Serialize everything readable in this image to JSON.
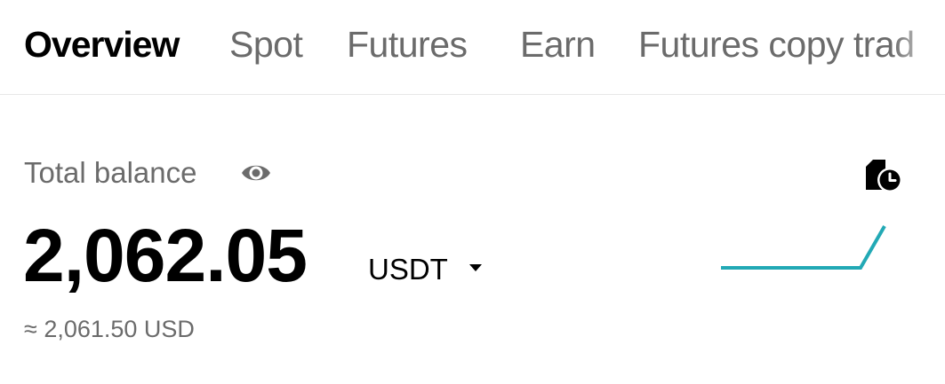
{
  "tabs": [
    {
      "label": "Overview",
      "active": true
    },
    {
      "label": "Spot",
      "active": false
    },
    {
      "label": "Futures",
      "active": false
    },
    {
      "label": "Earn",
      "active": false
    },
    {
      "label": "Futures copy trad",
      "active": false
    }
  ],
  "balance": {
    "label": "Total balance",
    "amount": "2,062.05",
    "currency": "USDT",
    "usd_equivalent": "≈ 2,061.50 USD",
    "visibility_icon": "eye-icon",
    "history_icon": "history-clock-icon"
  },
  "sparkline": {
    "color": "#22a9b5"
  },
  "colors": {
    "primary_text": "#000000",
    "secondary_text": "#6b6b6b",
    "accent": "#22a9b5",
    "divider": "#e8e8e8"
  }
}
